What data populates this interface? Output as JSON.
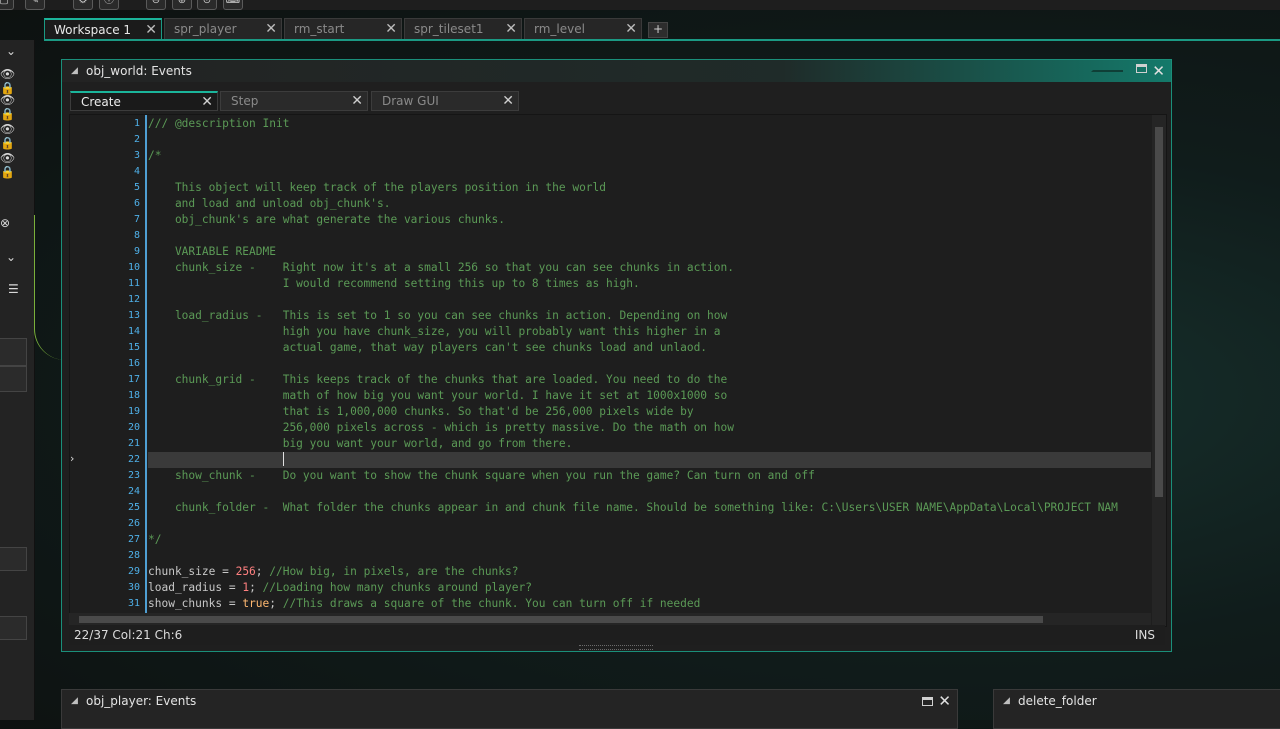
{
  "toolbar": {
    "icons": [
      "window-icon",
      "tag-icon",
      "gear-icon",
      "info-icon",
      "zoom-out-icon",
      "zoom-in-icon",
      "zoom-reset-icon",
      "gamepad-icon"
    ]
  },
  "workspace_tabs": [
    {
      "label": "Workspace 1",
      "active": true
    },
    {
      "label": "spr_player",
      "active": false
    },
    {
      "label": "rm_start",
      "active": false
    },
    {
      "label": "spr_tileset1",
      "active": false
    },
    {
      "label": "rm_level",
      "active": false
    }
  ],
  "add_tab_label": "+",
  "main_window": {
    "title": "obj_world: Events",
    "event_tabs": [
      {
        "label": "Create",
        "active": true
      },
      {
        "label": "Step",
        "active": false
      },
      {
        "label": "Draw GUI",
        "active": false
      }
    ],
    "code_lines": [
      {
        "n": "1",
        "text": "/// @description Init",
        "kind": "comment"
      },
      {
        "n": "2",
        "text": "",
        "kind": "comment"
      },
      {
        "n": "3",
        "text": "/*",
        "kind": "comment"
      },
      {
        "n": "4",
        "text": "",
        "kind": "comment"
      },
      {
        "n": "5",
        "text": "    This object will keep track of the players position in the world",
        "kind": "comment"
      },
      {
        "n": "6",
        "text": "    and load and unload obj_chunk's.",
        "kind": "comment"
      },
      {
        "n": "7",
        "text": "    obj_chunk's are what generate the various chunks.",
        "kind": "comment"
      },
      {
        "n": "8",
        "text": "",
        "kind": "comment"
      },
      {
        "n": "9",
        "text": "    VARIABLE README",
        "kind": "comment"
      },
      {
        "n": "10",
        "text": "    chunk_size -    Right now it's at a small 256 so that you can see chunks in action.",
        "kind": "comment"
      },
      {
        "n": "11",
        "text": "                    I would recommend setting this up to 8 times as high.",
        "kind": "comment"
      },
      {
        "n": "12",
        "text": "",
        "kind": "comment"
      },
      {
        "n": "13",
        "text": "    load_radius -   This is set to 1 so you can see chunks in action. Depending on how",
        "kind": "comment"
      },
      {
        "n": "14",
        "text": "                    high you have chunk_size, you will probably want this higher in a",
        "kind": "comment"
      },
      {
        "n": "15",
        "text": "                    actual game, that way players can't see chunks load and unlaod.",
        "kind": "comment"
      },
      {
        "n": "16",
        "text": "",
        "kind": "comment"
      },
      {
        "n": "17",
        "text": "    chunk_grid -    This keeps track of the chunks that are loaded. You need to do the",
        "kind": "comment"
      },
      {
        "n": "18",
        "text": "                    math of how big you want your world. I have it set at 1000x1000 so",
        "kind": "comment"
      },
      {
        "n": "19",
        "text": "                    that is 1,000,000 chunks. So that'd be 256,000 pixels wide by",
        "kind": "comment"
      },
      {
        "n": "20",
        "text": "                    256,000 pixels across - which is pretty massive. Do the math on how",
        "kind": "comment"
      },
      {
        "n": "21",
        "text": "                    big you want your world, and go from there.",
        "kind": "comment"
      },
      {
        "n": "22",
        "text": "                    ",
        "kind": "current"
      },
      {
        "n": "23",
        "text": "    show_chunk -    Do you want to show the chunk square when you run the game? Can turn on and off",
        "kind": "comment"
      },
      {
        "n": "24",
        "text": "",
        "kind": "comment"
      },
      {
        "n": "25",
        "text": "    chunk_folder -  What folder the chunks appear in and chunk file name. Should be something like: C:\\Users\\USER NAME\\AppData\\Local\\PROJECT NAM",
        "kind": "comment"
      },
      {
        "n": "26",
        "text": "",
        "kind": "comment"
      },
      {
        "n": "27",
        "text": "*/",
        "kind": "comment"
      },
      {
        "n": "28",
        "text": "",
        "kind": "comment"
      },
      {
        "n": "29",
        "var": "chunk_size",
        "op": " = ",
        "val": "256",
        "valkind": "num",
        "rest": "; ",
        "comment": "//How big, in pixels, are the chunks?",
        "kind": "code"
      },
      {
        "n": "30",
        "var": "load_radius",
        "op": " = ",
        "val": "1",
        "valkind": "num",
        "rest": "; ",
        "comment": "//Loading how many chunks around player?",
        "kind": "code"
      },
      {
        "n": "31",
        "var": "show_chunks",
        "op": " = ",
        "val": "true",
        "valkind": "kw",
        "rest": "; ",
        "comment": "//This draws a square of the chunk. You can turn off if needed",
        "kind": "code"
      }
    ],
    "status_position": "22/37 Col:21 Ch:6",
    "status_mode": "INS"
  },
  "bottom_windows": [
    {
      "title": "obj_player: Events"
    },
    {
      "title": "delete_folder"
    }
  ],
  "colors": {
    "accent": "#1bb59b",
    "comment": "#5b9a56",
    "number": "#ff8080",
    "keyword": "#ffb870",
    "line_number": "#4fb0e8"
  }
}
